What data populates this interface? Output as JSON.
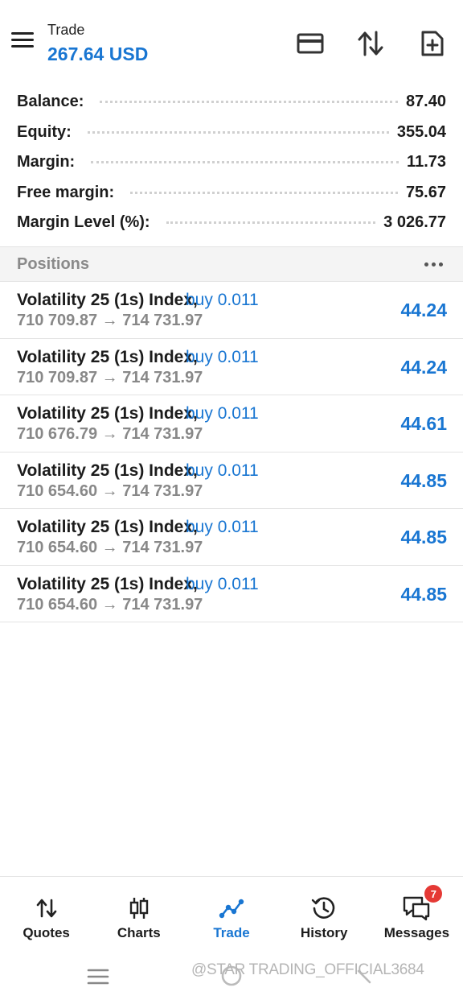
{
  "header": {
    "title": "Trade",
    "subtitle": "267.64 USD"
  },
  "summary": [
    {
      "label": "Balance:",
      "value": "87.40"
    },
    {
      "label": "Equity:",
      "value": "355.04"
    },
    {
      "label": "Margin:",
      "value": "11.73"
    },
    {
      "label": "Free margin:",
      "value": "75.67"
    },
    {
      "label": "Margin Level (%):",
      "value": "3 026.77"
    }
  ],
  "positions_section": {
    "title": "Positions"
  },
  "positions": [
    {
      "symbol": "Volatility 25 (1s) Index,",
      "direction": "buy 0.011",
      "prices": "710 709.87 → 714 731.97",
      "profit": "44.24"
    },
    {
      "symbol": "Volatility 25 (1s) Index,",
      "direction": "buy 0.011",
      "prices": "710 709.87 → 714 731.97",
      "profit": "44.24"
    },
    {
      "symbol": "Volatility 25 (1s) Index,",
      "direction": "buy 0.011",
      "prices": "710 676.79 → 714 731.97",
      "profit": "44.61"
    },
    {
      "symbol": "Volatility 25 (1s) Index,",
      "direction": "buy 0.011",
      "prices": "710 654.60 → 714 731.97",
      "profit": "44.85"
    },
    {
      "symbol": "Volatility 25 (1s) Index,",
      "direction": "buy 0.011",
      "prices": "710 654.60 → 714 731.97",
      "profit": "44.85"
    },
    {
      "symbol": "Volatility 25 (1s) Index,",
      "direction": "buy 0.011",
      "prices": "710 654.60 → 714 731.97",
      "profit": "44.85"
    }
  ],
  "tabs": [
    {
      "label": "Quotes",
      "icon": "quotes-icon"
    },
    {
      "label": "Charts",
      "icon": "charts-icon"
    },
    {
      "label": "Trade",
      "icon": "trade-icon",
      "active": true
    },
    {
      "label": "History",
      "icon": "history-icon"
    },
    {
      "label": "Messages",
      "icon": "messages-icon",
      "badge": "7"
    }
  ],
  "watermark": "@STAR TRADING_OFFICIAL3684",
  "colors": {
    "accent": "#1976d2",
    "badge": "#e53935",
    "muted": "#888888",
    "section_bg": "#f4f4f4"
  }
}
